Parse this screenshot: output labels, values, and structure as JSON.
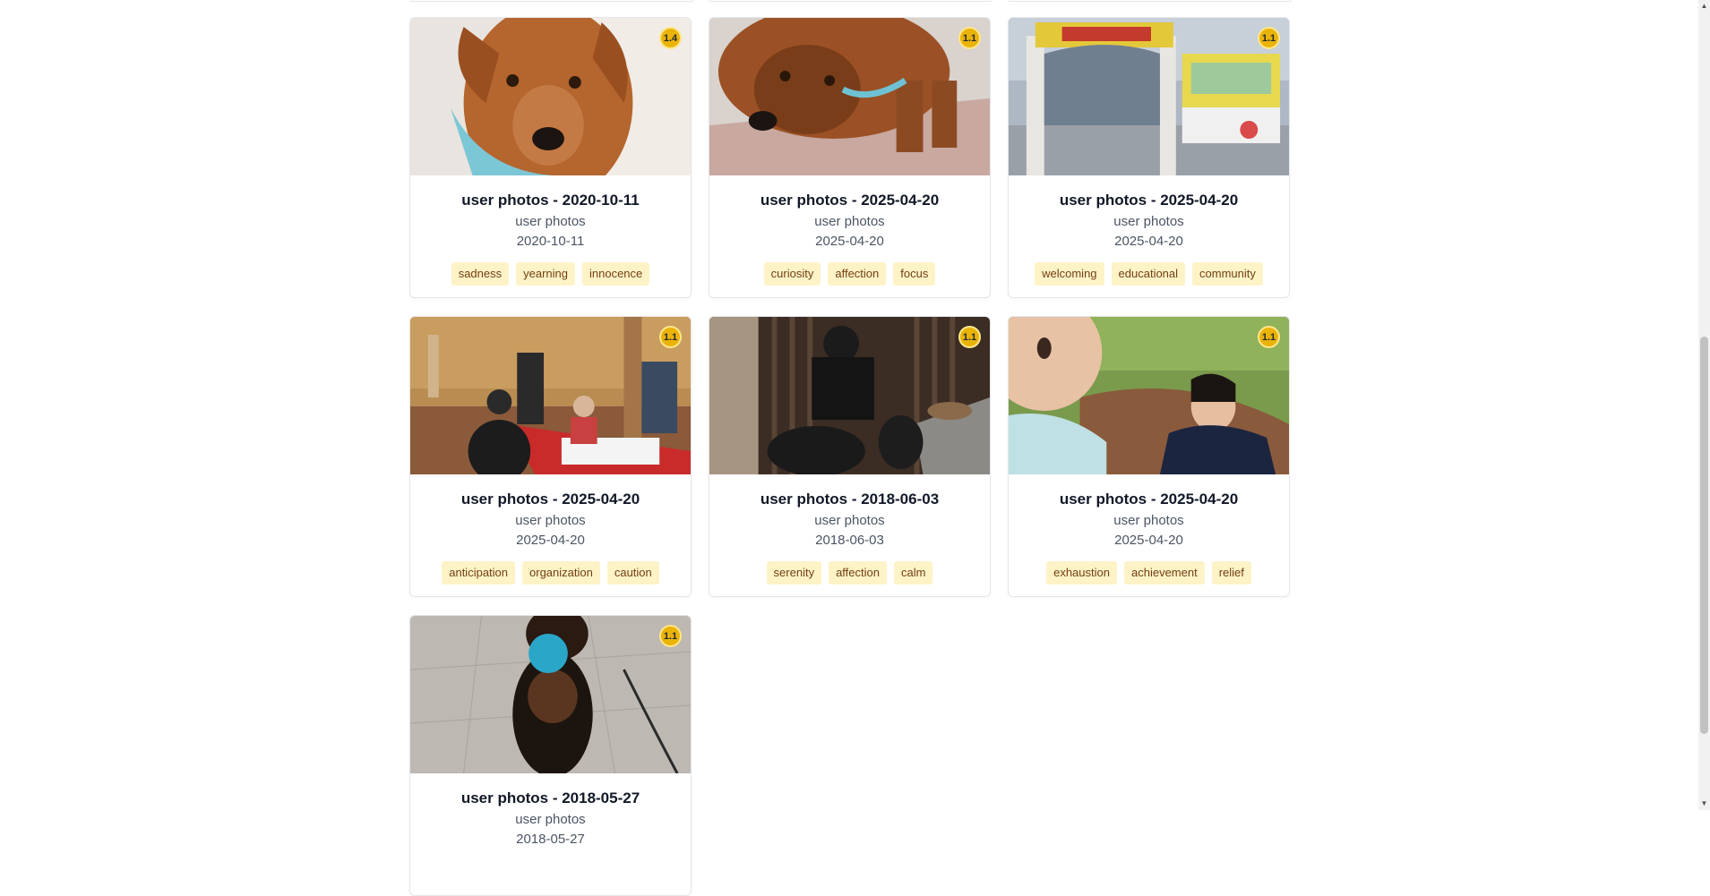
{
  "cards": [
    {
      "title": "user photos - 2020-10-11",
      "category": "user photos",
      "date": "2020-10-11",
      "score": "1.4",
      "tags": [
        "sadness",
        "yearning",
        "innocence"
      ]
    },
    {
      "title": "user photos - 2025-04-20",
      "category": "user photos",
      "date": "2025-04-20",
      "score": "1.1",
      "tags": [
        "curiosity",
        "affection",
        "focus"
      ]
    },
    {
      "title": "user photos - 2025-04-20",
      "category": "user photos",
      "date": "2025-04-20",
      "score": "1.1",
      "tags": [
        "welcoming",
        "educational",
        "community"
      ]
    },
    {
      "title": "user photos - 2025-04-20",
      "category": "user photos",
      "date": "2025-04-20",
      "score": "1.1",
      "tags": [
        "anticipation",
        "organization",
        "caution"
      ]
    },
    {
      "title": "user photos - 2018-06-03",
      "category": "user photos",
      "date": "2018-06-03",
      "score": "1.1",
      "tags": [
        "serenity",
        "affection",
        "calm"
      ]
    },
    {
      "title": "user photos - 2025-04-20",
      "category": "user photos",
      "date": "2025-04-20",
      "score": "1.1",
      "tags": [
        "exhaustion",
        "achievement",
        "relief"
      ]
    },
    {
      "title": "user photos - 2018-05-27",
      "category": "user photos",
      "date": "2018-05-27",
      "score": "1.1",
      "tags": []
    }
  ],
  "colors": {
    "badge": "#eab308",
    "tag_bg": "#fef3c7",
    "tag_text": "#713f12"
  },
  "scrollbar": {
    "up_icon": "▲",
    "down_icon": "▼"
  }
}
